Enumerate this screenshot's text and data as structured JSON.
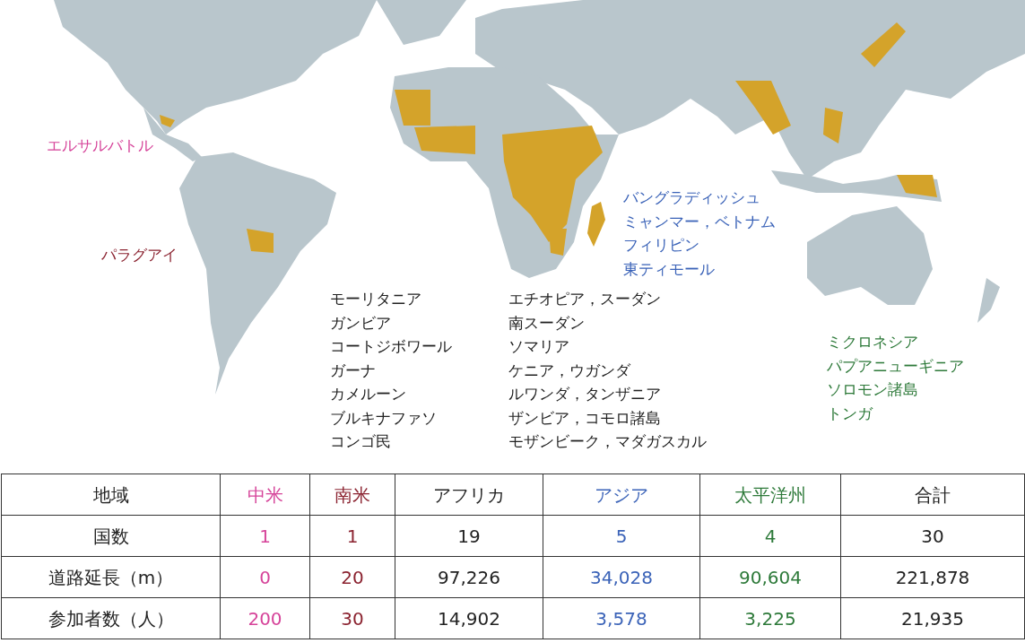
{
  "map": {
    "label_groups": [
      {
        "color": "#d6449a",
        "lines": [
          "エルサルバトル"
        ]
      },
      {
        "color": "#8b2330",
        "lines": [
          "パラグアイ"
        ]
      },
      {
        "color": "#222222",
        "lines": [
          "モーリタニア",
          "ガンビア",
          "コートジボワール",
          "ガーナ",
          "カメルーン",
          "ブルキナファソ",
          "コンゴ民"
        ]
      },
      {
        "color": "#222222",
        "lines": [
          "エチオピア，スーダン",
          "南スーダン",
          "ソマリア",
          "ケニア，ウガンダ",
          "ルワンダ，タンザニア",
          "ザンビア，コモロ諸島",
          "モザンビーク，マダガスカル"
        ]
      },
      {
        "color": "#3b63b8",
        "lines": [
          "バングラディッシュ",
          "ミャンマー，ベトナム",
          "フィリピン",
          "東ティモール"
        ]
      },
      {
        "color": "#2e7a3a",
        "lines": [
          "ミクロネシア",
          "パプアニューギニア",
          "ソロモン諸島",
          "トンガ"
        ]
      }
    ]
  },
  "table": {
    "columns": [
      {
        "label": "地域",
        "color": "#222222"
      },
      {
        "label": "中米",
        "color": "#d6449a"
      },
      {
        "label": "南米",
        "color": "#8b2330"
      },
      {
        "label": "アフリカ",
        "color": "#222222"
      },
      {
        "label": "アジア",
        "color": "#3b63b8"
      },
      {
        "label": "太平洋州",
        "color": "#2e7a3a"
      },
      {
        "label": "合計",
        "color": "#222222"
      }
    ],
    "rows": [
      [
        "国数",
        "1",
        "1",
        "19",
        "5",
        "4",
        "30"
      ],
      [
        "道路延長（m）",
        "0",
        "20",
        "97,226",
        "34,028",
        "90,604",
        "221,878"
      ],
      [
        "参加者数（人）",
        "200",
        "30",
        "14,902",
        "3,578",
        "3,225",
        "21,935"
      ]
    ]
  }
}
